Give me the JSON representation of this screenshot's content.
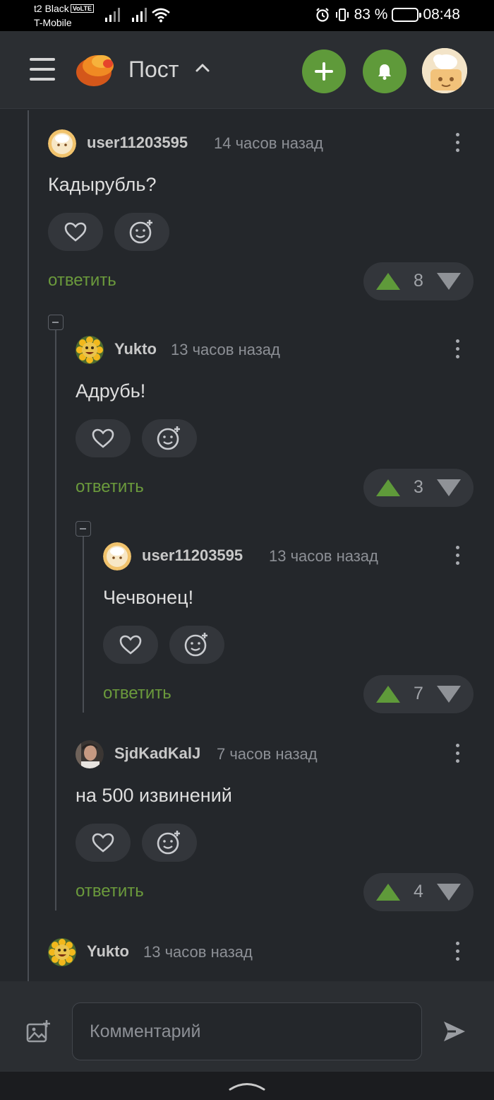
{
  "status_bar": {
    "carrier_primary": "t2 Black",
    "volte_badge": "VoLTE",
    "carrier_secondary": "T-Mobile",
    "battery_percent": "83 %",
    "battery_level": 0.83,
    "time": "08:48"
  },
  "header": {
    "title": "Пост",
    "icons": [
      "menu-icon",
      "pikabu-logo",
      "chevron-up-icon",
      "plus-icon",
      "bell-icon",
      "profile-avatar"
    ]
  },
  "comments": [
    {
      "user": "user11203595",
      "time": "14 часов назад",
      "text": "Кадырубль?",
      "reply_label": "ответить",
      "rating": "8"
    },
    {
      "user": "Yukto",
      "time": "13 часов назад",
      "text": "Адрубь!",
      "reply_label": "ответить",
      "rating": "3"
    },
    {
      "user": "user11203595",
      "time": "13 часов назад",
      "text": "Чечвонец!",
      "reply_label": "ответить",
      "rating": "7"
    },
    {
      "user": "SjdKadKalJ",
      "time": "7 часов назад",
      "text": "на 500 извинений",
      "reply_label": "ответить",
      "rating": "4"
    },
    {
      "user": "Yukto",
      "time": "13 часов назад"
    }
  ],
  "composer": {
    "placeholder": "Комментарий"
  },
  "colors": {
    "background": "#24272b",
    "accent_green": "#5f9a3a",
    "reply_green": "#6b9a3c"
  }
}
